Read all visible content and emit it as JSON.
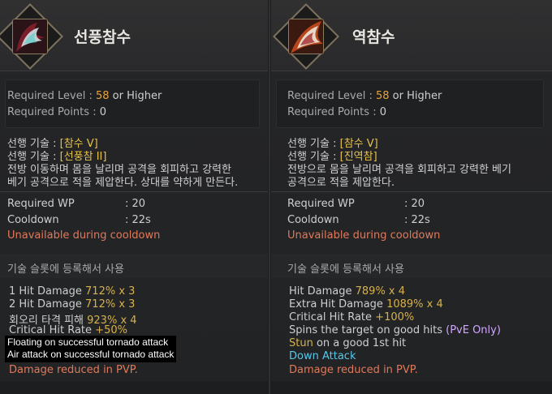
{
  "left": {
    "title": "선풍참수",
    "req_level_label": "Required Level",
    "req_level_value": "58",
    "req_level_suffix": "or Higher",
    "req_points_label": "Required Points",
    "req_points_value": "0",
    "prereq1_label": "선행 기술 :",
    "prereq1_value": "[참수 V]",
    "prereq2_label": "선행 기술 :",
    "prereq2_value": "[선풍참 II]",
    "desc1": "전방 이동하며 몸을 날리며 공격을 회피하고 강력한",
    "desc2": "베기 공격으로 적을 제압한다. 상대를 약하게 만든다.",
    "wp_label": "Required WP",
    "wp_value": ": 20",
    "cd_label": "Cooldown",
    "cd_value": ": 22s",
    "unavailable": "Unavailable during cooldown",
    "slot_note": "기술 슬롯에 등록해서 사용",
    "effects": [
      {
        "label": "1 Hit Damage",
        "value": "712% x 3"
      },
      {
        "label": "2 Hit Damage",
        "value": "712% x 3"
      },
      {
        "label": "회오리 타격 피해",
        "value": "923% x 4"
      },
      {
        "label": "Critical Hit Rate",
        "value": "+50%"
      }
    ],
    "tooltip1": "Floating on successful tornado attack",
    "tooltip2": "Air attack on successful tornado attack",
    "pvp": "Damage reduced in PVP."
  },
  "right": {
    "title": "역참수",
    "req_level_label": "Required Level",
    "req_level_value": "58",
    "req_level_suffix": "or Higher",
    "req_points_label": "Required Points",
    "req_points_value": "0",
    "prereq1_label": "선행 기술 :",
    "prereq1_value": "[참수 V]",
    "prereq2_label": "선행 기술 :",
    "prereq2_value": "[진역참]",
    "desc1": "전방으로 몸을 날리며 공격을 회피하고 강력한 베기",
    "desc2": "공격으로 적을 제압한다.",
    "wp_label": "Required WP",
    "wp_value": ": 20",
    "cd_label": "Cooldown",
    "cd_value": ": 22s",
    "unavailable": "Unavailable during cooldown",
    "slot_note": "기술 슬롯에 등록해서 사용",
    "effects": [
      {
        "label": "Hit Damage",
        "value": "789% x 4"
      },
      {
        "label": "Extra Hit Damage",
        "value": "1089% x 4"
      },
      {
        "label": "Critical Hit Rate",
        "value": "+100%"
      }
    ],
    "spin_text": "Spins the target on good hits",
    "spin_note": "(PvE Only)",
    "stun_word": "Stun",
    "stun_text": "on a good 1st hit",
    "down_attack": "Down Attack",
    "pvp": "Damage reduced in PVP."
  },
  "colors": {
    "level_orange": "#e9a33a",
    "skill_yellow": "#d8b14a",
    "red_note": "#e2795a",
    "cyan": "#57c8e8",
    "purple": "#d2a7ff"
  },
  "icons": {
    "left": "tornado-slash-skill-icon",
    "right": "reverse-slash-skill-icon"
  }
}
